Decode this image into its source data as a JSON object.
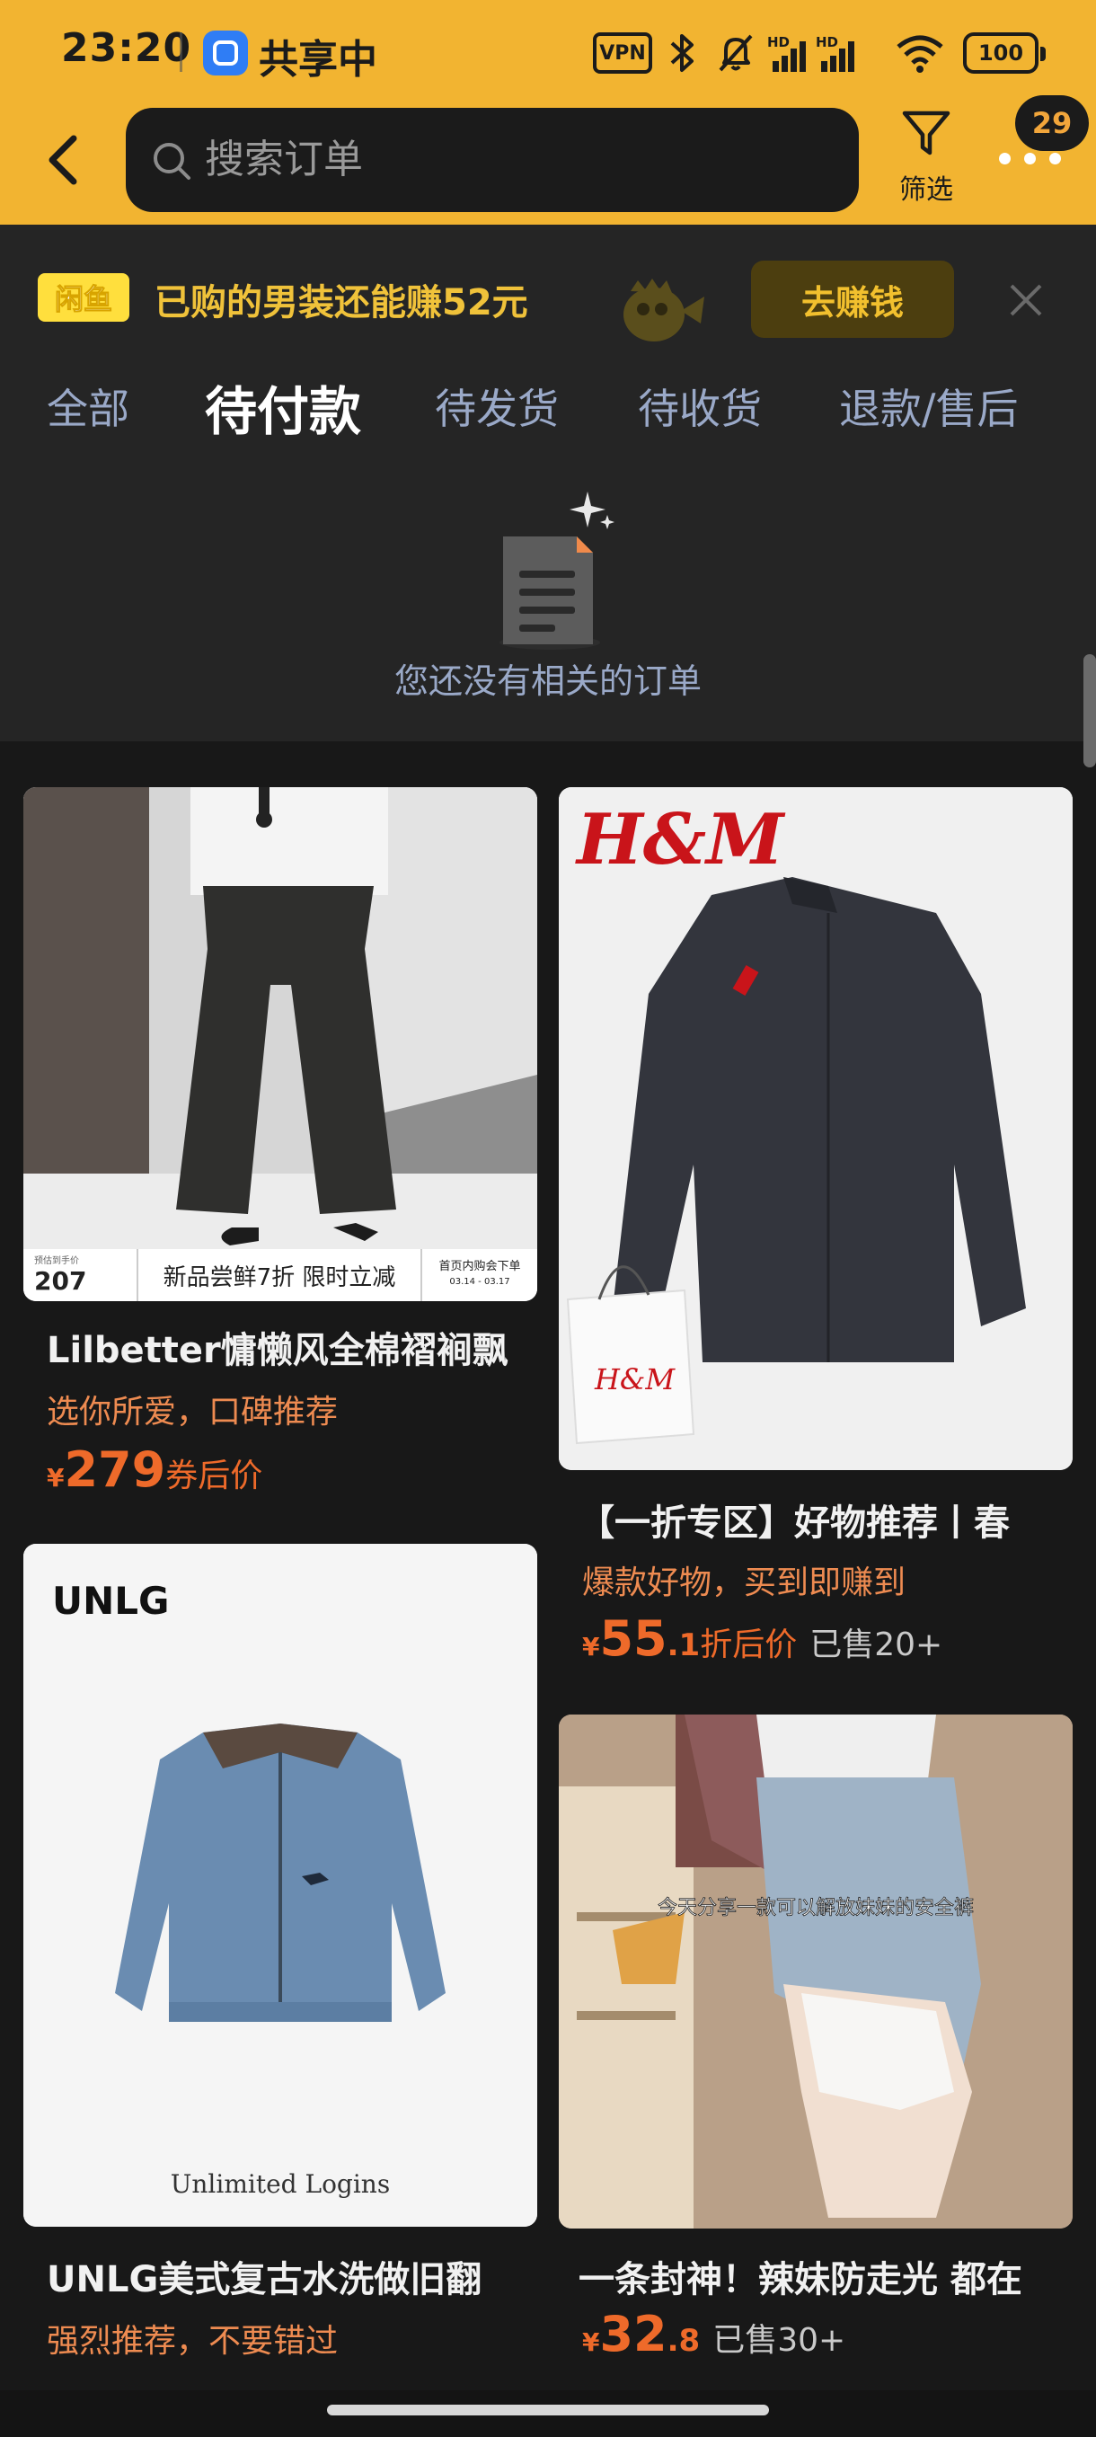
{
  "status_bar": {
    "time": "23:20",
    "sharing": "共享中",
    "vpn": "VPN",
    "battery": "100",
    "network": [
      "HD",
      "HD"
    ]
  },
  "header": {
    "search_placeholder": "搜索订单",
    "filter_label": "筛选",
    "badge_count": "29"
  },
  "promo": {
    "logo_text": "闲鱼",
    "text": "已购的男装还能赚52元",
    "button": "去赚钱"
  },
  "tabs": [
    {
      "label": "全部",
      "active": false
    },
    {
      "label": "待付款",
      "active": true
    },
    {
      "label": "待发货",
      "active": false
    },
    {
      "label": "待收货",
      "active": false
    },
    {
      "label": "退款/售后",
      "active": false
    }
  ],
  "empty_state": {
    "text": "您还没有相关的订单"
  },
  "products": [
    {
      "title": "Lilbetter慵懒风全棉褶裥飘",
      "subtitle": "选你所爱，口碑推荐",
      "currency": "¥",
      "price_int": "279",
      "price_dec": "",
      "price_suffix": "券后价",
      "sold": "",
      "image_overlay": {
        "est_label": "预估到手价",
        "est_price": "207",
        "promo": "新品尝鲜7折 限时立减",
        "tag": "首页内购会下单",
        "dates": "03.14 - 03.17"
      }
    },
    {
      "title": "【一折专区】好物推荐丨春",
      "subtitle": "爆款好物，买到即赚到",
      "currency": "¥",
      "price_int": "55",
      "price_dec": ".1",
      "price_suffix": "折后价",
      "sold": "已售20+",
      "image_overlay": {
        "brand": "H&M",
        "bag_brand": "H&M"
      }
    },
    {
      "title": "UNLG美式复古水洗做旧翻",
      "subtitle": "强烈推荐，不要错过",
      "currency": "¥",
      "price_int": "",
      "price_dec": "",
      "price_suffix": "",
      "sold": "",
      "image_overlay": {
        "brand": "UNLG",
        "caption": "Unlimited  Logins"
      }
    },
    {
      "title": "一条封神！辣妹防走光 都在",
      "subtitle": "",
      "currency": "¥",
      "price_int": "32",
      "price_dec": ".8",
      "price_suffix": "",
      "sold": "已售30+",
      "image_overlay": {
        "caption": "今天分享一款可以解放妹妹的安全裤"
      }
    }
  ],
  "icons": [
    "back-icon",
    "search-icon",
    "filter-icon",
    "more-icon",
    "close-icon",
    "document-icon",
    "bluetooth-icon",
    "mute-icon",
    "signal-icon",
    "wifi-icon"
  ],
  "colors": {
    "header": "#f2b431",
    "background": "#181818",
    "panel": "#252525",
    "price": "#ee6a2a",
    "tab_inactive": "#9aa9c8",
    "promo_text": "#f0c23a"
  }
}
